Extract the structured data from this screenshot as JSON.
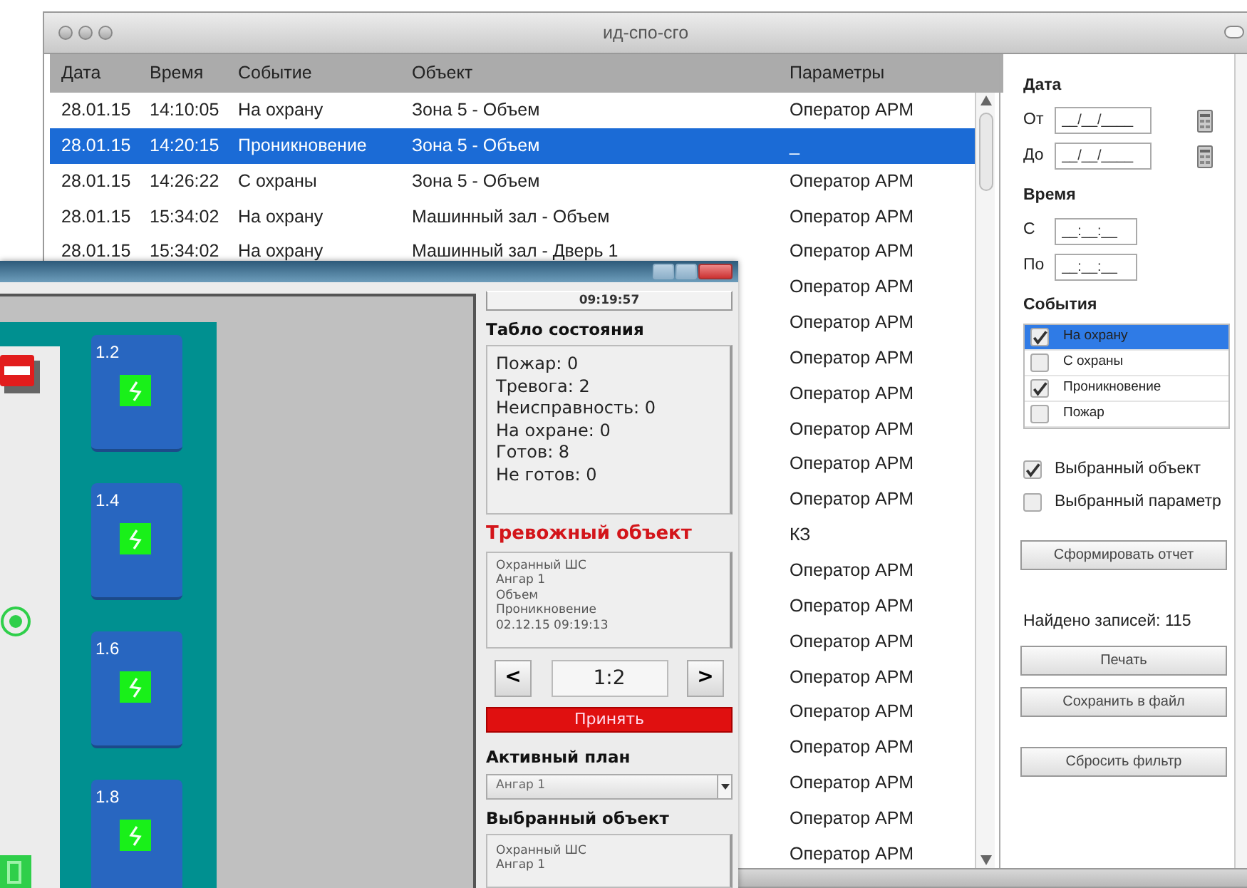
{
  "main_window": {
    "title": "ид-спо-сго"
  },
  "events_table": {
    "columns": [
      "Дата",
      "Время",
      "Событие",
      "Объект",
      "Параметры"
    ],
    "rows": [
      {
        "date": "28.01.15",
        "time": "14:10:05",
        "event": "На охрану",
        "object": "Зона 5 - Объем",
        "parameters": "Оператор АРМ",
        "selected": false
      },
      {
        "date": "28.01.15",
        "time": "14:20:15",
        "event": "Проникновение",
        "object": "Зона 5 - Объем",
        "parameters": "_",
        "selected": true
      },
      {
        "date": "28.01.15",
        "time": "14:26:22",
        "event": "С охраны",
        "object": "Зона 5 - Объем",
        "parameters": "Оператор АРМ",
        "selected": false
      },
      {
        "date": "28.01.15",
        "time": "15:34:02",
        "event": "На охрану",
        "object": "Машинный зал - Объем",
        "parameters": "Оператор АРМ",
        "selected": false
      },
      {
        "date": "28.01.15",
        "time": "15:34:02",
        "event": "На охрану",
        "object": "Машинный зал - Дверь 1",
        "parameters": "Оператор АРМ",
        "selected": false
      },
      {
        "parameters": "Оператор АРМ",
        "selected": false
      },
      {
        "parameters": "Оператор АРМ",
        "selected": false
      },
      {
        "parameters": "Оператор АРМ",
        "selected": false
      },
      {
        "parameters": "Оператор АРМ",
        "selected": false
      },
      {
        "parameters": "Оператор АРМ",
        "selected": false
      },
      {
        "parameters": "Оператор АРМ",
        "selected": false
      },
      {
        "parameters": "Оператор АРМ",
        "selected": false
      },
      {
        "parameters": "КЗ",
        "selected": false
      },
      {
        "parameters": "Оператор АРМ",
        "selected": false
      },
      {
        "parameters": "Оператор АРМ",
        "selected": false
      },
      {
        "parameters": "Оператор АРМ",
        "selected": false
      },
      {
        "parameters": "Оператор АРМ",
        "selected": false
      },
      {
        "parameters": "Оператор АРМ",
        "selected": false
      },
      {
        "parameters": "Оператор АРМ",
        "selected": false
      },
      {
        "parameters": "Оператор АРМ",
        "selected": false
      },
      {
        "parameters": "Оператор АРМ",
        "selected": false
      },
      {
        "parameters": "Оператор АРМ",
        "selected": false
      }
    ]
  },
  "filter_panel": {
    "date_label": "Дата",
    "date_from": {
      "label": "От",
      "placeholder": "__/__/____"
    },
    "date_to": {
      "label": "До",
      "placeholder": "__/__/____"
    },
    "time_label": "Время",
    "time_from": {
      "label": "С",
      "placeholder": "__:__:__"
    },
    "time_to": {
      "label": "По",
      "placeholder": "__:__:__"
    },
    "events_label": "События",
    "events": [
      {
        "label": "На охрану",
        "checked": true,
        "selected": true
      },
      {
        "label": "С охраны",
        "checked": false,
        "selected": false
      },
      {
        "label": "Проникновение",
        "checked": true,
        "selected": false
      },
      {
        "label": "Пожар",
        "checked": false,
        "selected": false
      }
    ],
    "options": [
      {
        "label": "Выбранный объект",
        "checked": true
      },
      {
        "label": "Выбранный параметр",
        "checked": false
      }
    ],
    "report_button": "Сформировать отчет",
    "found": "Найдено записей: 115",
    "buttons": [
      "Печать",
      "Сохранить в файл"
    ],
    "reset_button": "Сбросить фильтр"
  },
  "monitor_window": {
    "clock": "09:19:57",
    "status_title": "Табло состояния",
    "status_lines": [
      "Пожар: 0",
      "Тревога: 2",
      "Неисправность: 0",
      "На охране: 0",
      "Готов: 8",
      "Не готов: 0"
    ],
    "alarm_title": "Тревожный объект",
    "alarm_lines": [
      "Охранный ШС",
      "Ангар 1",
      "Объем",
      "Проникновение",
      "02.12.15 09:19:13"
    ],
    "pager": {
      "prev": "<",
      "value": "1:2",
      "next": ">"
    },
    "accept_button": "Принять",
    "plan_label": "Активный план",
    "plan_value": "Ангар 1",
    "selected_title": "Выбранный объект",
    "selected_lines": [
      "Охранный ШС",
      "Ангар 1"
    ],
    "zones": [
      {
        "label": "1.2"
      },
      {
        "label": "1.4"
      },
      {
        "label": "1.6"
      },
      {
        "label": "1.8"
      }
    ]
  }
}
